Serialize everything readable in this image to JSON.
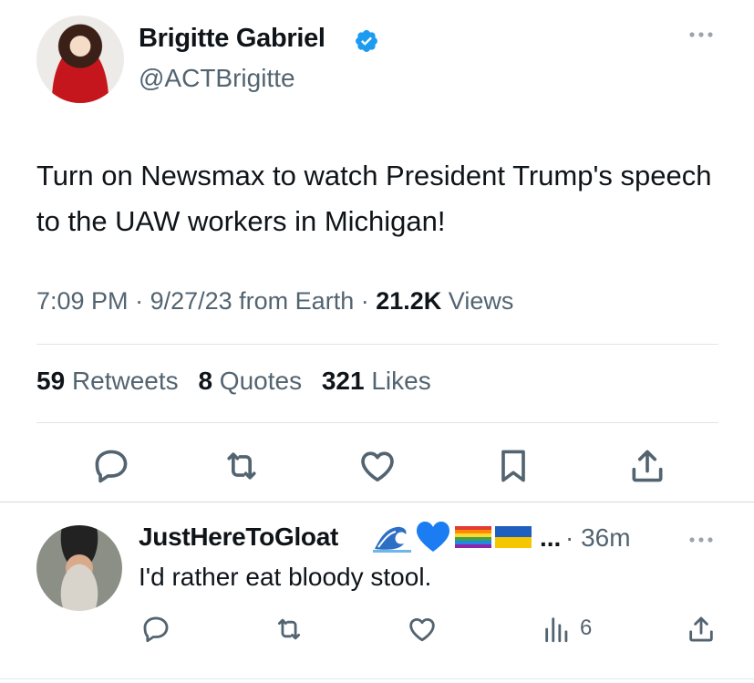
{
  "tweet": {
    "author": {
      "display_name": "Brigitte Gabriel",
      "handle": "@ACTBrigitte",
      "verified": true
    },
    "text": "Turn on Newsmax to watch President Trump's speech to the UAW workers in Michigan!",
    "meta": {
      "time": "7:09 PM",
      "date": "9/27/23",
      "source": "from Earth",
      "sep": " · ",
      "views_count": "21.2K",
      "views_label": "Views"
    },
    "stats": {
      "retweets_count": "59",
      "retweets_label": "Retweets",
      "quotes_count": "8",
      "quotes_label": "Quotes",
      "likes_count": "321",
      "likes_label": "Likes"
    },
    "actions": [
      "reply-icon",
      "retweet-icon",
      "like-icon",
      "bookmark-icon",
      "share-icon"
    ]
  },
  "reply": {
    "author": {
      "display_name": "JustHereToGloat",
      "emojis": [
        "wave-icon",
        "blue-heart-icon",
        "rainbow-flag-icon",
        "ukraine-flag-icon"
      ],
      "truncation": "..."
    },
    "time": "· 36m",
    "text": "I'd rather eat bloody stool.",
    "views": "6",
    "actions": [
      "reply-icon",
      "retweet-icon",
      "like-icon",
      "views-icon",
      "share-icon"
    ]
  },
  "colors": {
    "text_primary": "#0f1419",
    "text_secondary": "#536471",
    "verified_blue": "#1d9bf0",
    "divider": "#e1e6ea"
  }
}
